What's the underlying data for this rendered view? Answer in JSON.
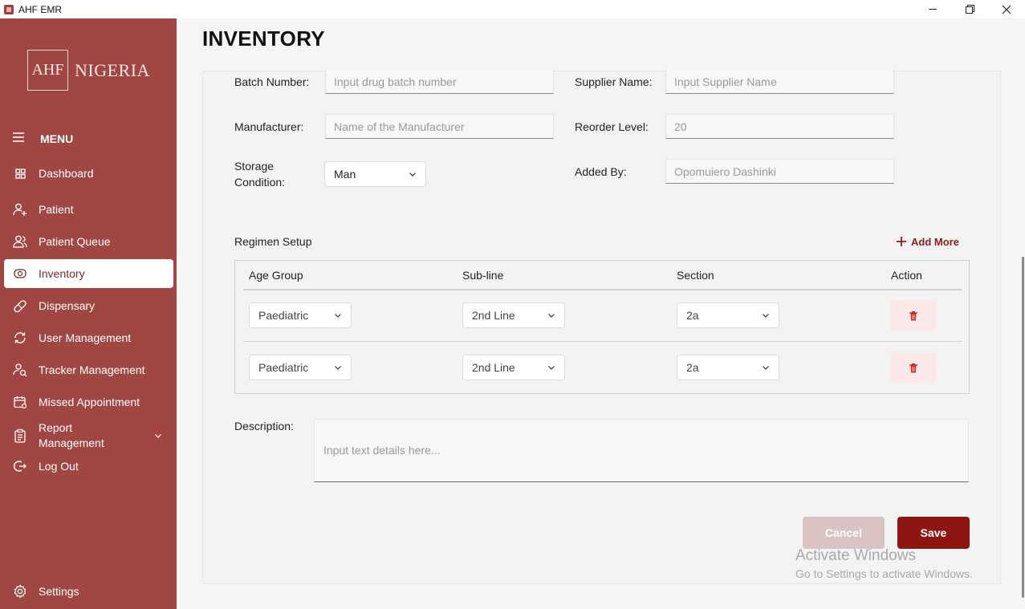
{
  "window": {
    "title": "AHF EMR",
    "minimize": "—",
    "restore": "❐",
    "close": "✕"
  },
  "logo": {
    "mark": "AHF",
    "text": "NIGERIA"
  },
  "sidebar": {
    "menu_label": "MENU",
    "items": [
      {
        "label": "Dashboard",
        "icon": "grid-icon"
      },
      {
        "label": "Patient",
        "icon": "user-plus-icon"
      },
      {
        "label": "Patient Queue",
        "icon": "users-icon"
      },
      {
        "label": "Inventory",
        "icon": "inventory-icon",
        "active": true
      },
      {
        "label": "Dispensary",
        "icon": "pill-icon"
      },
      {
        "label": "User Management",
        "icon": "refresh-users-icon"
      },
      {
        "label": "Tracker Management",
        "icon": "tracker-icon"
      },
      {
        "label": "Missed Appointment",
        "icon": "calendar-icon"
      },
      {
        "label": "Report Management",
        "icon": "clipboard-icon"
      },
      {
        "label": "Log Out",
        "icon": "logout-icon"
      }
    ],
    "settings_label": "Settings"
  },
  "page": {
    "title": "INVENTORY"
  },
  "form": {
    "batch_number": {
      "label": "Batch Number:",
      "placeholder": "Input drug batch number"
    },
    "supplier_name": {
      "label": "Supplier Name:",
      "placeholder": "Input Supplier Name"
    },
    "manufacturer": {
      "label": "Manufacturer:",
      "placeholder": "Name of the Manufacturer"
    },
    "reorder_level": {
      "label": "Reorder Level:",
      "value": "20"
    },
    "storage_condition": {
      "label": "Storage Condition:",
      "value": "Man"
    },
    "added_by": {
      "label": "Added By:",
      "value": "Opomuiero Dashinki"
    }
  },
  "regimen": {
    "title": "Regimen Setup",
    "add_more": "Add More",
    "headers": [
      "Age Group",
      "Sub-line",
      "Section",
      "Action"
    ],
    "rows": [
      {
        "age_group": "Paediatric",
        "sub_line": "2nd Line",
        "section": "2a"
      },
      {
        "age_group": "Paediatric",
        "sub_line": "2nd Line",
        "section": "2a"
      }
    ]
  },
  "description": {
    "label": "Description:",
    "placeholder": "Input text details here..."
  },
  "actions": {
    "cancel": "Cancel",
    "save": "Save"
  },
  "watermark": {
    "title": "Activate Windows",
    "subtitle": "Go to Settings to activate Windows."
  },
  "colors": {
    "sidebar": "#a04643",
    "accent": "#8e1612",
    "cancel": "#d9c3c3",
    "delete_bg": "#fbe9e9"
  }
}
